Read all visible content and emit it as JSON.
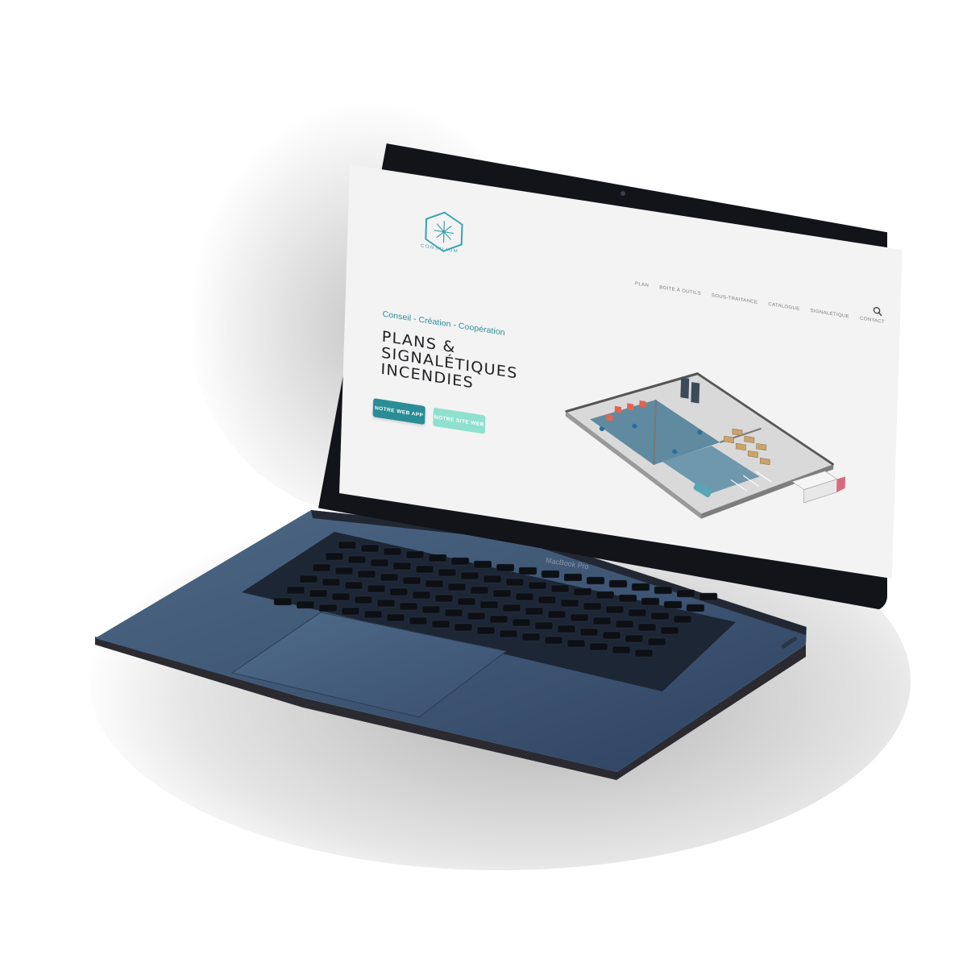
{
  "device": {
    "model_label": "MacBook Pro"
  },
  "site": {
    "brand": "CONSILIUM",
    "nav": [
      "PLAN",
      "BOITE À OUTILS",
      "SOUS-TRAITANCE",
      "CATALOGUE",
      "SIGNALÉTIQUE",
      "CONTACT"
    ],
    "tagline": "Conseil - Création - Coopération",
    "headline": [
      "PLANS &",
      "SIGNALÉTIQUES",
      "INCENDIES"
    ],
    "buttons": {
      "primary": "NOTRE WEB APP",
      "secondary": "NOTRE SITE WEB"
    }
  },
  "colors": {
    "accent": "#2a8d96",
    "accent_light": "#8fe0cf",
    "laptop_body": "#3e5673",
    "bezel": "#121419",
    "page_background": "#f3f3f3"
  },
  "icons": [
    "search-icon",
    "logo-hexagon-icon"
  ]
}
